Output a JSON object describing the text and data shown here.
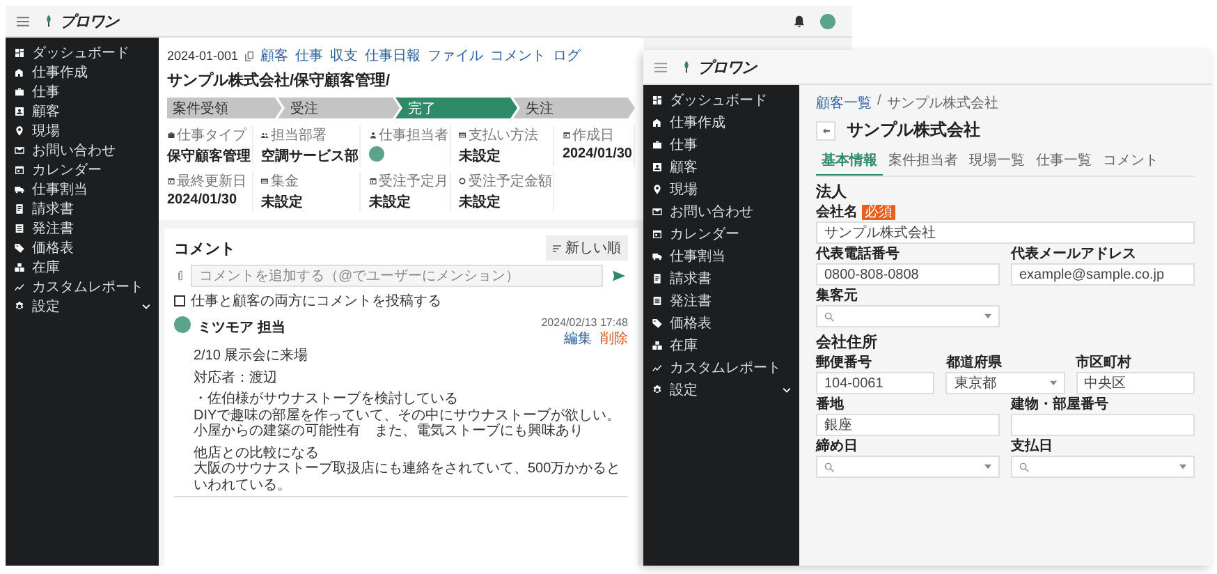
{
  "left_window": {
    "app_name": "プロワン",
    "sidebar": [
      {
        "label": "ダッシュボード",
        "has_submenu": false
      },
      {
        "label": "仕事作成",
        "has_submenu": false
      },
      {
        "label": "仕事",
        "has_submenu": false
      },
      {
        "label": "顧客",
        "has_submenu": false
      },
      {
        "label": "現場",
        "has_submenu": false
      },
      {
        "label": "お問い合わせ",
        "has_submenu": false
      },
      {
        "label": "カレンダー",
        "has_submenu": false
      },
      {
        "label": "仕事割当",
        "has_submenu": false
      },
      {
        "label": "請求書",
        "has_submenu": false
      },
      {
        "label": "発注書",
        "has_submenu": false
      },
      {
        "label": "価格表",
        "has_submenu": false
      },
      {
        "label": "在庫",
        "has_submenu": false
      },
      {
        "label": "カスタムレポート",
        "has_submenu": false
      },
      {
        "label": "設定",
        "has_submenu": true
      }
    ],
    "job_id": "2024-01-001",
    "nav_links": [
      "顧客",
      "仕事",
      "収支",
      "仕事日報",
      "ファイル",
      "コメント",
      "ログ"
    ],
    "title": "サンプル株式会社/保守顧客管理/",
    "stages": [
      {
        "label": "案件受領",
        "selected": false
      },
      {
        "label": "受注",
        "selected": false
      },
      {
        "label": "完了",
        "selected": true
      },
      {
        "label": "失注",
        "selected": false
      }
    ],
    "fields": [
      {
        "label": "仕事タイプ",
        "kind": "text",
        "value": "保守顧客管理"
      },
      {
        "label": "担当部署",
        "kind": "text",
        "value": "空調サービス部"
      },
      {
        "label": "仕事担当者",
        "kind": "avatar"
      },
      {
        "label": "支払い方法",
        "kind": "text",
        "value": "未設定"
      },
      {
        "label": "作成日",
        "kind": "text",
        "value": "2024/01/30"
      },
      {
        "label": "最終更新日",
        "kind": "text",
        "value": "2024/01/30"
      },
      {
        "label": "集金",
        "kind": "text",
        "value": "未設定"
      },
      {
        "label": "受注予定月",
        "kind": "text",
        "value": "未設定"
      },
      {
        "label": "受注予定金額",
        "kind": "text",
        "value": "未設定"
      }
    ],
    "comments": {
      "title": "コメント",
      "sort_button": "新しい順",
      "placeholder": "コメントを追加する（@でユーザーにメンション）",
      "cross_post": {
        "label": "仕事と顧客の両方にコメントを投稿する",
        "checked": false
      },
      "items": [
        {
          "author": "ミツモア 担当",
          "time": "2024/02/13 17:48",
          "edit": "編集",
          "delete": "削除",
          "paragraphs": [
            [
              "2/10 展示会に来場"
            ],
            [
              "対応者：渡辺"
            ],
            [
              "・佐伯様がサウナストーブを検討している",
              "DIYで趣味の部屋を作っていて、その中にサウナストーブが欲しい。",
              "小屋からの建築の可能性有　また、電気ストーブにも興味あり"
            ],
            [
              "他店との比較になる",
              "大阪のサウナストーブ取扱店にも連絡をされていて、500万かかるといわれている。"
            ]
          ]
        }
      ]
    }
  },
  "right_window": {
    "app_name": "プロワン",
    "sidebar": [
      {
        "label": "ダッシュボード",
        "has_submenu": false
      },
      {
        "label": "仕事作成",
        "has_submenu": false
      },
      {
        "label": "仕事",
        "has_submenu": false
      },
      {
        "label": "顧客",
        "has_submenu": false
      },
      {
        "label": "現場",
        "has_submenu": false
      },
      {
        "label": "お問い合わせ",
        "has_submenu": false
      },
      {
        "label": "カレンダー",
        "has_submenu": false
      },
      {
        "label": "仕事割当",
        "has_submenu": false
      },
      {
        "label": "請求書",
        "has_submenu": false
      },
      {
        "label": "発注書",
        "has_submenu": false
      },
      {
        "label": "価格表",
        "has_submenu": false
      },
      {
        "label": "在庫",
        "has_submenu": false
      },
      {
        "label": "カスタムレポート",
        "has_submenu": false
      },
      {
        "label": "設定",
        "has_submenu": true
      }
    ],
    "breadcrumb": [
      "顧客一覧",
      "サンプル株式会社"
    ],
    "breadcrumb_separator": "/",
    "title": "サンプル株式会社",
    "tabs": [
      {
        "label": "基本情報",
        "selected": true
      },
      {
        "label": "案件担当者",
        "selected": false
      },
      {
        "label": "現場一覧",
        "selected": false
      },
      {
        "label": "仕事一覧",
        "selected": false
      },
      {
        "label": "コメント",
        "selected": false
      }
    ],
    "sections": [
      {
        "heading": "法人",
        "rows": [
          [
            {
              "label": "会社名",
              "badge": "必須",
              "kind": "input",
              "value": "サンプル株式会社"
            }
          ],
          [
            {
              "label": "代表電話番号",
              "kind": "input",
              "value": "0800-808-0808"
            },
            {
              "label": "代表メールアドレス",
              "kind": "input",
              "value": "example@sample.co.jp"
            }
          ],
          [
            {
              "label": "集客元",
              "kind": "search-select"
            }
          ]
        ]
      },
      {
        "heading": "会社住所",
        "rows": [
          [
            {
              "label": "郵便番号",
              "kind": "input",
              "value": "104-0061"
            },
            {
              "label": "都道府県",
              "kind": "select",
              "value": "東京都"
            },
            {
              "label": "市区町村",
              "kind": "input",
              "value": "中央区"
            }
          ],
          [
            {
              "label": "番地",
              "kind": "input",
              "value": "銀座"
            },
            {
              "label": "建物・部屋番号",
              "kind": "input"
            }
          ],
          [
            {
              "label": "締め日",
              "kind": "search-select"
            },
            {
              "label": "支払日",
              "kind": "search-select"
            }
          ]
        ]
      }
    ]
  }
}
